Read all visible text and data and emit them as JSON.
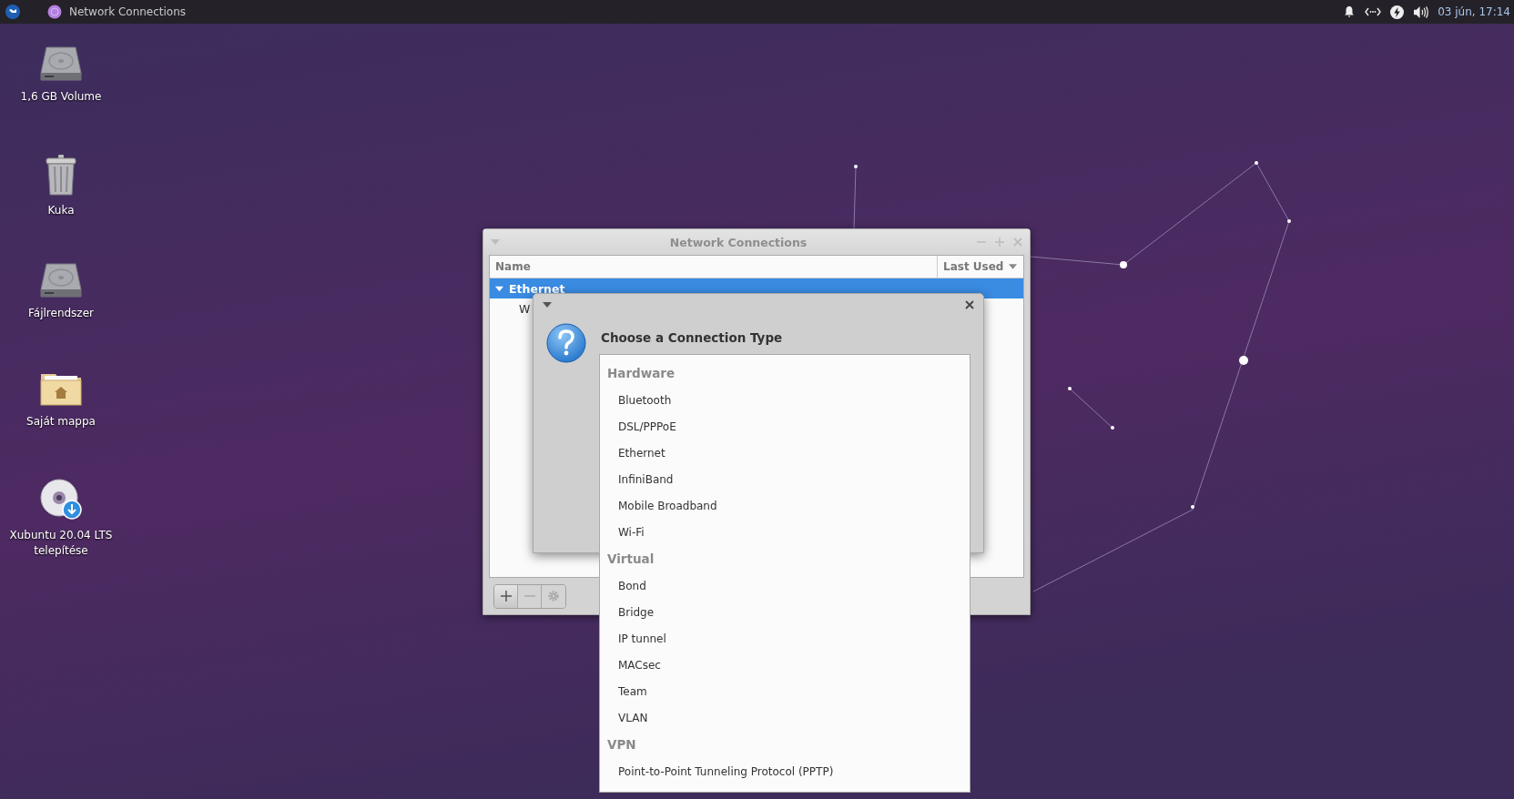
{
  "top_panel": {
    "app_title": "Network Connections",
    "clock": "03 jún, 17:14"
  },
  "desktop_icons": [
    {
      "label": "1,6 GB Volume",
      "kind": "drive"
    },
    {
      "label": "Kuka",
      "kind": "trash"
    },
    {
      "label": "Fájlrendszer",
      "kind": "drive"
    },
    {
      "label": "Saját mappa",
      "kind": "home"
    },
    {
      "label": "Xubuntu 20.04 LTS telepítése",
      "kind": "disc"
    }
  ],
  "network_window": {
    "title": "Network Connections",
    "columns": [
      "Name",
      "Last Used"
    ],
    "rows": [
      {
        "label": "Ethernet",
        "expanded": true,
        "selected": true,
        "children": [
          {
            "label": "W"
          }
        ]
      }
    ],
    "toolbar": [
      {
        "kind": "add",
        "disabled": false
      },
      {
        "kind": "remove",
        "disabled": true
      },
      {
        "kind": "settings",
        "disabled": true
      }
    ]
  },
  "dialog": {
    "title": "Choose a Connection Type",
    "groups": [
      {
        "heading": "Hardware",
        "items": [
          "Bluetooth",
          "DSL/PPPoE",
          "Ethernet",
          "InfiniBand",
          "Mobile Broadband",
          "Wi-Fi"
        ]
      },
      {
        "heading": "Virtual",
        "items": [
          "Bond",
          "Bridge",
          "IP tunnel",
          "MACsec",
          "Team",
          "VLAN"
        ]
      },
      {
        "heading": "VPN",
        "items": [
          "Point-to-Point Tunneling Protocol (PPTP)"
        ]
      }
    ]
  }
}
